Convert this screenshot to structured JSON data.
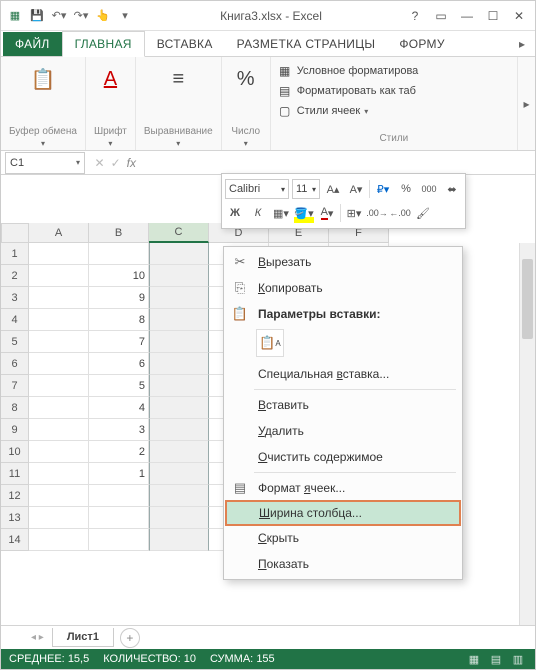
{
  "title": "Книга3.xlsx - Excel",
  "qat": {
    "save": "💾",
    "undo": "↶",
    "redo": "↷"
  },
  "tabs": {
    "file": "ФАЙЛ",
    "home": "ГЛАВНАЯ",
    "insert": "ВСТАВКА",
    "layout": "РАЗМЕТКА СТРАНИЦЫ",
    "formulas": "ФОРМУ"
  },
  "ribbon": {
    "clipboard": {
      "label": "Буфер обмена"
    },
    "font": {
      "label": "Шрифт"
    },
    "align": {
      "label": "Выравнивание"
    },
    "number": {
      "label": "Число"
    },
    "styles": {
      "label": "Стили",
      "cond": "Условное форматирова",
      "table": "Форматировать как таб",
      "cell": "Стили ячеек"
    }
  },
  "namebox": "C1",
  "mini": {
    "font": "Calibri",
    "size": "11",
    "bold": "Ж",
    "italic": "К",
    "percent": "%",
    "thousands": "000"
  },
  "columns": [
    "A",
    "B",
    "C",
    "D",
    "E",
    "F"
  ],
  "rows": [
    "1",
    "2",
    "3",
    "4",
    "5",
    "6",
    "7",
    "8",
    "9",
    "10",
    "11",
    "12",
    "13",
    "14"
  ],
  "cells_b": [
    "",
    "10",
    "9",
    "8",
    "7",
    "6",
    "5",
    "4",
    "3",
    "2",
    "1",
    "",
    "",
    ""
  ],
  "context": {
    "cut": "Вырезать",
    "copy": "Копировать",
    "paste_opts": "Параметры вставки:",
    "paste_special": "Специальная вставка...",
    "insert": "Вставить",
    "delete": "Удалить",
    "clear": "Очистить содержимое",
    "format_cells": "Формат ячеек...",
    "col_width": "Ширина столбца...",
    "hide": "Скрыть",
    "show": "Показать",
    "cut_u": "В",
    "copy_u": "К",
    "ps_u": "в",
    "ins_u": "В",
    "del_u": "У",
    "clr_u": "О",
    "fc_u": "я",
    "cw_u": "Ш",
    "hide_u": "С",
    "show_u": "П"
  },
  "sheet": {
    "name": "Лист1"
  },
  "status": {
    "avg_label": "СРЕДНЕЕ:",
    "avg": "15,5",
    "count_label": "КОЛИЧЕСТВО:",
    "count": "10",
    "sum_label": "СУММА:",
    "sum": "155"
  }
}
